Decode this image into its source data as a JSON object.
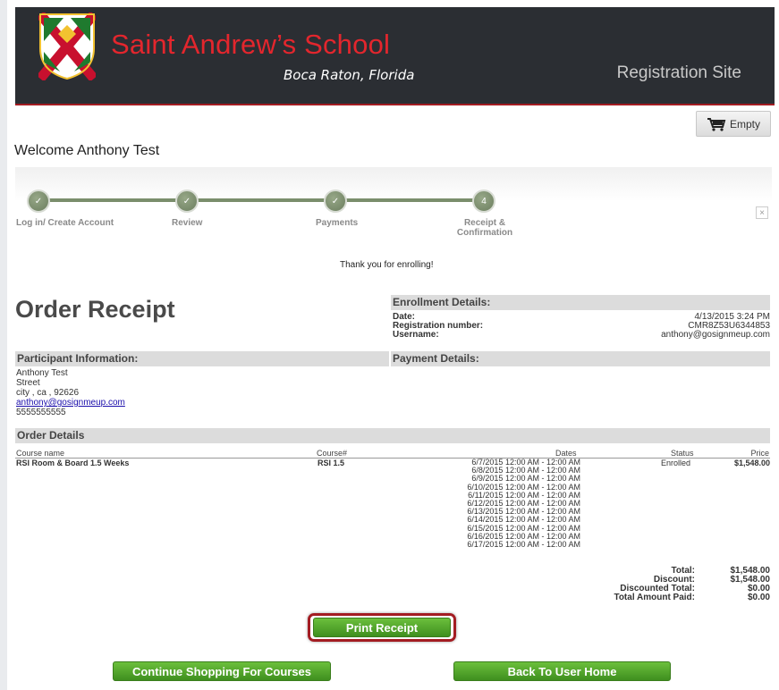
{
  "header": {
    "school_name": "Saint Andrew’s School",
    "school_city": "Boca Raton, Florida",
    "site_name": "Registration Site"
  },
  "cart": {
    "label": "Empty"
  },
  "welcome": "Welcome Anthony Test",
  "steps": [
    {
      "num": "4",
      "label": "Log in/ Create Account"
    },
    {
      "label": "Review"
    },
    {
      "label": "Payments"
    },
    {
      "label_line1": "Receipt &",
      "label_line2": "Confirmation"
    }
  ],
  "thanks": "Thank you for enrolling!",
  "order_title": "Order Receipt",
  "enrollment": {
    "heading": "Enrollment Details:",
    "date_label": "Date:",
    "date_value": "4/13/2015 3:24 PM",
    "reg_label": "Registration number:",
    "reg_value": "CMR8Z53U6344853",
    "user_label": "Username:",
    "user_value": "anthony@gosignmeup.com"
  },
  "participant": {
    "heading": "Participant Information:",
    "name": "Anthony Test",
    "street": "Street",
    "city": "city , ca , 92626",
    "email": "anthony@gosignmeup.com",
    "phone": "5555555555"
  },
  "payment": {
    "heading": "Payment Details:"
  },
  "order_details": {
    "heading": "Order Details",
    "columns": {
      "course_name": "Course name",
      "course_num": "Course#",
      "dates": "Dates",
      "status": "Status",
      "price": "Price"
    },
    "row": {
      "course_name": "RSI Room & Board 1.5 Weeks",
      "course_num": "RSI 1.5",
      "status": "Enrolled",
      "price": "$1,548.00",
      "dates": [
        "6/7/2015 12:00 AM - 12:00 AM",
        "6/8/2015 12:00 AM - 12:00 AM",
        "6/9/2015 12:00 AM - 12:00 AM",
        "6/10/2015 12:00 AM - 12:00 AM",
        "6/11/2015 12:00 AM - 12:00 AM",
        "6/12/2015 12:00 AM - 12:00 AM",
        "6/13/2015 12:00 AM - 12:00 AM",
        "6/14/2015 12:00 AM - 12:00 AM",
        "6/15/2015 12:00 AM - 12:00 AM",
        "6/16/2015 12:00 AM - 12:00 AM",
        "6/17/2015 12:00 AM - 12:00 AM"
      ]
    },
    "totals": {
      "total_label": "Total:",
      "total_value": "$1,548.00",
      "discount_label": "Discount:",
      "discount_value": "$1,548.00",
      "disc_total_label": "Discounted Total:",
      "disc_total_value": "$0.00",
      "paid_label": "Total Amount Paid:",
      "paid_value": "$0.00"
    }
  },
  "buttons": {
    "print": "Print Receipt",
    "continue": "Continue Shopping For Courses",
    "home": "Back To User Home"
  },
  "close_symbol": "×",
  "colors": {
    "header_bg": "#2b2e33",
    "brand_red": "#e3262d",
    "button_green": "#4fa82b",
    "step_green": "#7a8e6c"
  }
}
